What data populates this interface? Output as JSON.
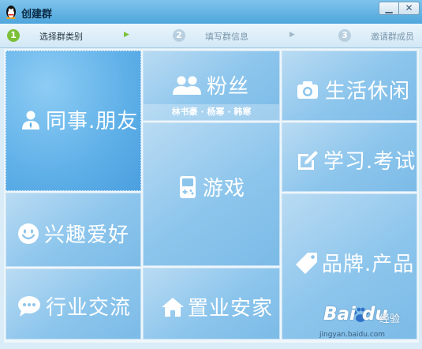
{
  "window": {
    "title": "创建群",
    "minimize_label": "▁",
    "close_label": "✕"
  },
  "steps": [
    {
      "number": "1",
      "label": "选择群类别",
      "state": "active"
    },
    {
      "number": "2",
      "label": "填写群信息",
      "state": "inactive"
    },
    {
      "number": "3",
      "label": "邀请群成员",
      "state": "inactive"
    }
  ],
  "colors": {
    "active_step": "#7cc03a",
    "inactive_step": "#b8cfdf",
    "tile_light": "#8cc5ec",
    "tile_selected": "#5fb0e8"
  },
  "categories": {
    "colleagues": {
      "label": "同事.朋友",
      "icon": "person-icon",
      "selected": true
    },
    "fans": {
      "label": "粉丝",
      "icon": "people-icon",
      "subtitle": "林书豪 · 杨幂 · 韩寒"
    },
    "life": {
      "label": "生活休闲",
      "icon": "camera-icon"
    },
    "interests": {
      "label": "兴趣爱好",
      "icon": "smiley-icon"
    },
    "games": {
      "label": "游戏",
      "icon": "gameboy-icon"
    },
    "study": {
      "label": "学习.考试",
      "icon": "edit-icon"
    },
    "industry": {
      "label": "行业交流",
      "icon": "chat-icon"
    },
    "realestate": {
      "label": "置业安家",
      "icon": "house-icon"
    },
    "brands": {
      "label": "品牌.产品",
      "icon": "tag-icon"
    }
  },
  "watermark": {
    "brand": "Bai du",
    "cn": "经验",
    "url": "jingyan.baidu.com"
  }
}
